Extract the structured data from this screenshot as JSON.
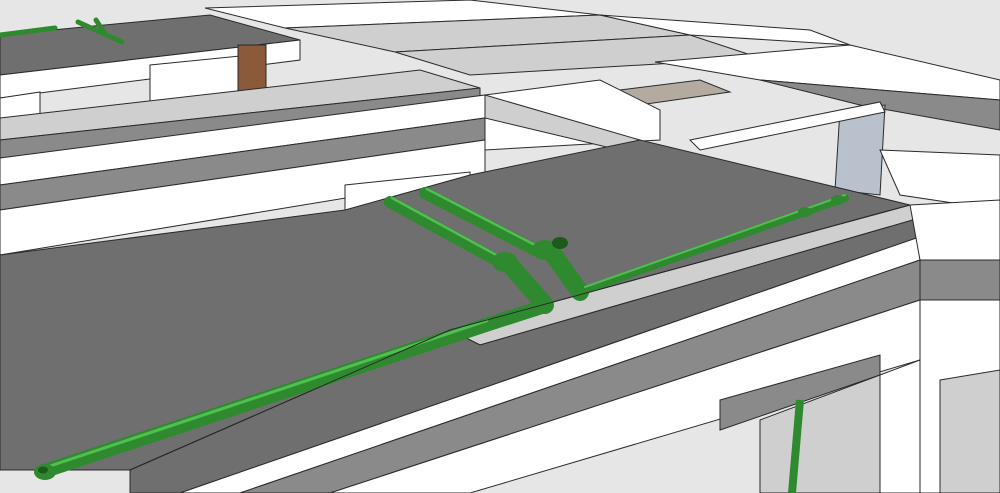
{
  "scene": {
    "subject": "3d-model-render",
    "colors": {
      "background": "#e6e6e6",
      "slab_top": "#6f6f6f",
      "slab_front": "#ffffff",
      "beam_dark": "#8a8a8a",
      "beam_light": "#cfcfcf",
      "edge": "#2a2a2a",
      "pipe": "#2f8a2f",
      "pipe_highlight": "#4fbf4f",
      "pipe_shadow": "#1c5a1c",
      "brick": "#8a5a3a",
      "concrete_texture": "#b3aaa0",
      "glass": "#b9c2cc"
    }
  }
}
